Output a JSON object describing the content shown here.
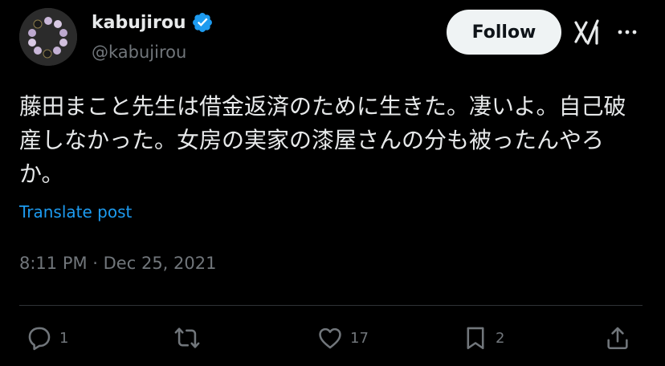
{
  "author": {
    "display_name": "kabujirou",
    "handle": "@kabujirou",
    "verified": true,
    "verified_color": "#1d9bf0"
  },
  "header": {
    "follow_label": "Follow",
    "grok_icon": "grok-icon",
    "more_icon": "more-icon"
  },
  "tweet": {
    "text": "藤田まこと先生は借金返済のために生きた。凄いよ。自己破産しなかった。女房の実家の漆屋さんの分も被ったんやろか。",
    "translate_label": "Translate post",
    "timestamp": "8:11 PM · Dec 25, 2021"
  },
  "actions": {
    "reply": {
      "icon": "reply-icon",
      "count": "1"
    },
    "repost": {
      "icon": "repost-icon",
      "count": ""
    },
    "like": {
      "icon": "like-icon",
      "count": "17"
    },
    "bookmark": {
      "icon": "bookmark-icon",
      "count": "2"
    },
    "share": {
      "icon": "share-icon"
    }
  },
  "colors": {
    "background": "#000000",
    "text": "#e7e9ea",
    "secondary": "#71767b",
    "accent": "#1d9bf0",
    "follow_bg": "#eff3f4"
  }
}
